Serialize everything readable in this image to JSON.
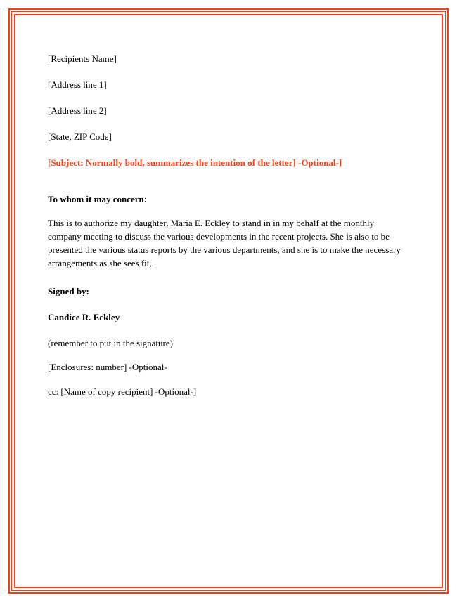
{
  "recipient": {
    "name_placeholder": "[Recipients Name]",
    "address_line_1": "[Address line 1]",
    "address_line_2": "[Address line 2]",
    "state_zip": "[State, ZIP Code]"
  },
  "subject_line": "[Subject: Normally bold, summarizes the intention of the letter] -Optional-]",
  "salutation": "To whom it may concern:",
  "body": "This is to authorize my daughter, Maria E. Eckley to stand in in my behalf at the monthly company meeting to discuss the various developments in the recent projects. She is also to be presented the various status reports by the various departments, and she is to make the necessary arrangements as she sees fit,.",
  "signed_by_label": "Signed by:",
  "signer_name": "Candice R. Eckley",
  "signature_note": "(remember to put in the signature)",
  "enclosures": "[Enclosures: number] -Optional-",
  "cc": "cc: [Name of copy recipient] -Optional-]"
}
